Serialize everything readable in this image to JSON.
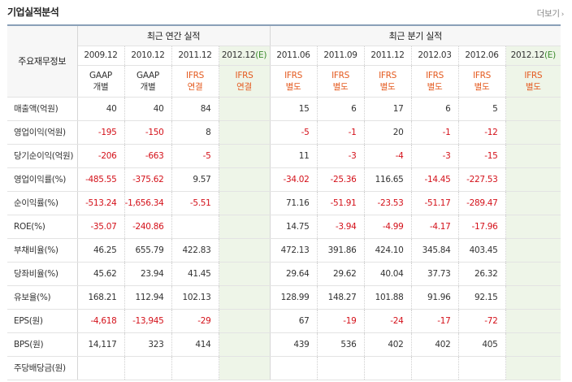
{
  "header": {
    "title": "기업실적분석",
    "more": "더보기"
  },
  "table": {
    "label_header": "주요재무정보",
    "groups": [
      "최근 연간 실적",
      "최근 분기 실적"
    ],
    "periods": [
      {
        "date": "2009.12",
        "est": "",
        "std1": "GAAP",
        "std2": "개별",
        "std_type": "gaap"
      },
      {
        "date": "2010.12",
        "est": "",
        "std1": "GAAP",
        "std2": "개별",
        "std_type": "gaap"
      },
      {
        "date": "2011.12",
        "est": "",
        "std1": "IFRS",
        "std2": "연결",
        "std_type": "ifrs"
      },
      {
        "date": "2012.12",
        "est": "(E)",
        "std1": "IFRS",
        "std2": "연결",
        "std_type": "ifrs"
      },
      {
        "date": "2011.06",
        "est": "",
        "std1": "IFRS",
        "std2": "별도",
        "std_type": "ifrs"
      },
      {
        "date": "2011.09",
        "est": "",
        "std1": "IFRS",
        "std2": "별도",
        "std_type": "ifrs"
      },
      {
        "date": "2011.12",
        "est": "",
        "std1": "IFRS",
        "std2": "별도",
        "std_type": "ifrs"
      },
      {
        "date": "2012.03",
        "est": "",
        "std1": "IFRS",
        "std2": "별도",
        "std_type": "ifrs"
      },
      {
        "date": "2012.06",
        "est": "",
        "std1": "IFRS",
        "std2": "별도",
        "std_type": "ifrs"
      },
      {
        "date": "2012.12",
        "est": "(E)",
        "std1": "IFRS",
        "std2": "별도",
        "std_type": "ifrs"
      }
    ],
    "rows": [
      {
        "label": "매출액(억원)",
        "values": [
          "40",
          "40",
          "84",
          "",
          "15",
          "6",
          "17",
          "6",
          "5",
          ""
        ]
      },
      {
        "label": "영업이익(억원)",
        "values": [
          "-195",
          "-150",
          "8",
          "",
          "-5",
          "-1",
          "20",
          "-1",
          "-12",
          ""
        ]
      },
      {
        "label": "당기순이익(억원)",
        "values": [
          "-206",
          "-663",
          "-5",
          "",
          "11",
          "-3",
          "-4",
          "-3",
          "-15",
          ""
        ]
      },
      {
        "label": "영업이익률(%)",
        "values": [
          "-485.55",
          "-375.62",
          "9.57",
          "",
          "-34.02",
          "-25.36",
          "116.65",
          "-14.45",
          "-227.53",
          ""
        ]
      },
      {
        "label": "순이익률(%)",
        "values": [
          "-513.24",
          "-1,656.34",
          "-5.51",
          "",
          "71.16",
          "-51.91",
          "-23.53",
          "-51.17",
          "-289.47",
          ""
        ]
      },
      {
        "label": "ROE(%)",
        "values": [
          "-35.07",
          "-240.86",
          "",
          "",
          "14.75",
          "-3.94",
          "-4.99",
          "-4.17",
          "-17.96",
          ""
        ]
      },
      {
        "label": "부채비율(%)",
        "values": [
          "46.25",
          "655.79",
          "422.83",
          "",
          "472.13",
          "391.86",
          "424.10",
          "345.84",
          "403.45",
          ""
        ]
      },
      {
        "label": "당좌비율(%)",
        "values": [
          "45.62",
          "23.94",
          "41.45",
          "",
          "29.64",
          "29.62",
          "40.04",
          "37.73",
          "26.32",
          ""
        ]
      },
      {
        "label": "유보율(%)",
        "values": [
          "168.21",
          "112.94",
          "102.13",
          "",
          "128.99",
          "148.27",
          "101.88",
          "91.96",
          "92.15",
          ""
        ]
      },
      {
        "label": "EPS(원)",
        "values": [
          "-4,618",
          "-13,945",
          "-29",
          "",
          "67",
          "-19",
          "-24",
          "-17",
          "-72",
          ""
        ]
      },
      {
        "label": "BPS(원)",
        "values": [
          "14,117",
          "323",
          "414",
          "",
          "439",
          "536",
          "402",
          "402",
          "405",
          ""
        ]
      },
      {
        "label": "주당배당금(원)",
        "values": [
          "",
          "",
          "",
          "",
          "",
          "",
          "",
          "",
          "",
          ""
        ]
      }
    ]
  },
  "colors": {
    "negative": "#d4111a",
    "ifrs": "#e45a1f",
    "estimate_bg": "#eef5e8",
    "estimate_mark": "#3a8a2c"
  }
}
